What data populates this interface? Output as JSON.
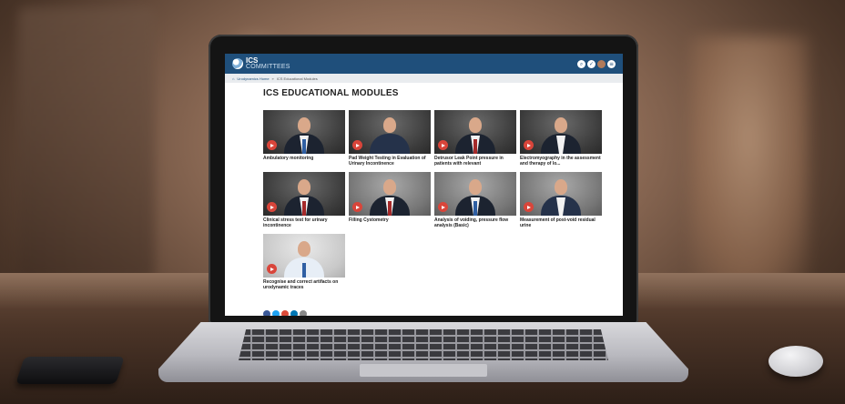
{
  "header": {
    "logo_ics": "ICS",
    "logo_committees": "COMMITTEES",
    "icons": [
      "search-icon",
      "check-icon",
      "user-avatar",
      "menu-icon"
    ]
  },
  "breadcrumb": {
    "home": "Urodynamics Home",
    "separator": "»",
    "current": "ICS Educational Modules"
  },
  "page": {
    "title": "ICS EDUCATIONAL MODULES"
  },
  "modules": [
    {
      "title": "Ambulatory monitoring"
    },
    {
      "title": "Pad Weight Testing in Evaluation of Urinary Incontinence"
    },
    {
      "title": "Detrusor Leak Point pressure in patients with relevant"
    },
    {
      "title": "Electromyography in the assessment and therapy of lo..."
    },
    {
      "title": "Clinical stress test for urinary incontinence"
    },
    {
      "title": "Filling Cystometry"
    },
    {
      "title": "Analysis of voiding, pressure flow analysis (Basic)"
    },
    {
      "title": "Measurement of post-void residual urine"
    },
    {
      "title": "Recognise and correct artifacts on urodynamic traces"
    }
  ],
  "colors": {
    "header_bg": "#1f4f7b",
    "play_button": "#d9453a",
    "share": [
      "#3b5998",
      "#1da1f2",
      "#dd4b39",
      "#0077b5",
      "#888888"
    ]
  }
}
